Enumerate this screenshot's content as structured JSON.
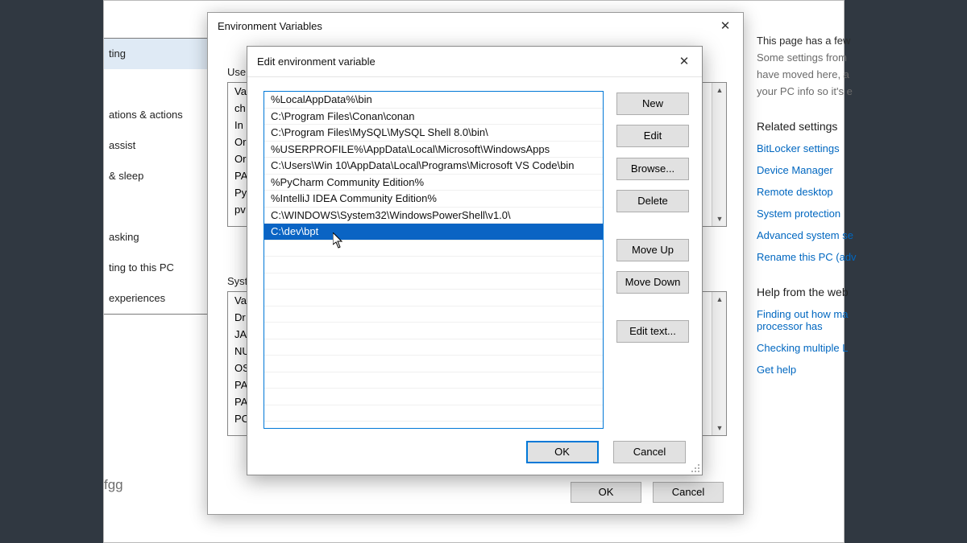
{
  "settings": {
    "sidebar_items": [
      "ting",
      "",
      "ations & actions",
      "assist",
      "& sleep",
      "",
      "asking",
      "ting to this PC",
      "experiences"
    ],
    "fgg_label": "fgg",
    "right": {
      "intro_line1": "This page has a few",
      "intro_line2": "Some settings from",
      "intro_line3": "have moved here, a",
      "intro_line4": "your PC info so it's e",
      "related_header": "Related settings",
      "links": [
        "BitLocker settings",
        "Device Manager",
        "Remote desktop",
        "System protection",
        "Advanced system se",
        "Rename this PC (adv"
      ],
      "help_header": "Help from the web",
      "help_links": [
        "Finding out how ma",
        "processor has",
        "Checking multiple L"
      ],
      "get_help": "Get help"
    }
  },
  "env_parent": {
    "title": "Environment Variables",
    "user_group_label": "User",
    "user_items": [
      "Va",
      "ch",
      "In",
      "Or",
      "Or",
      "PA",
      "Py",
      "pv"
    ],
    "sys_group_label": "Syste",
    "sys_items": [
      "Va",
      "Dr",
      "JA",
      "NU",
      "OS",
      "PA",
      "PA",
      "PC"
    ],
    "ok_label": "OK",
    "cancel_label": "Cancel"
  },
  "edit_dialog": {
    "title": "Edit environment variable",
    "entries": [
      "%LocalAppData%\\bin",
      "C:\\Program Files\\Conan\\conan",
      "C:\\Program Files\\MySQL\\MySQL Shell 8.0\\bin\\",
      "%USERPROFILE%\\AppData\\Local\\Microsoft\\WindowsApps",
      "C:\\Users\\Win 10\\AppData\\Local\\Programs\\Microsoft VS Code\\bin",
      "%PyCharm Community Edition%",
      "%IntelliJ IDEA Community Edition%",
      "C:\\WINDOWS\\System32\\WindowsPowerShell\\v1.0\\",
      "C:\\dev\\bpt"
    ],
    "selected_index": 8,
    "buttons": {
      "new": "New",
      "edit": "Edit",
      "browse": "Browse...",
      "delete": "Delete",
      "move_up": "Move Up",
      "move_down": "Move Down",
      "edit_text": "Edit text...",
      "ok": "OK",
      "cancel": "Cancel"
    }
  }
}
